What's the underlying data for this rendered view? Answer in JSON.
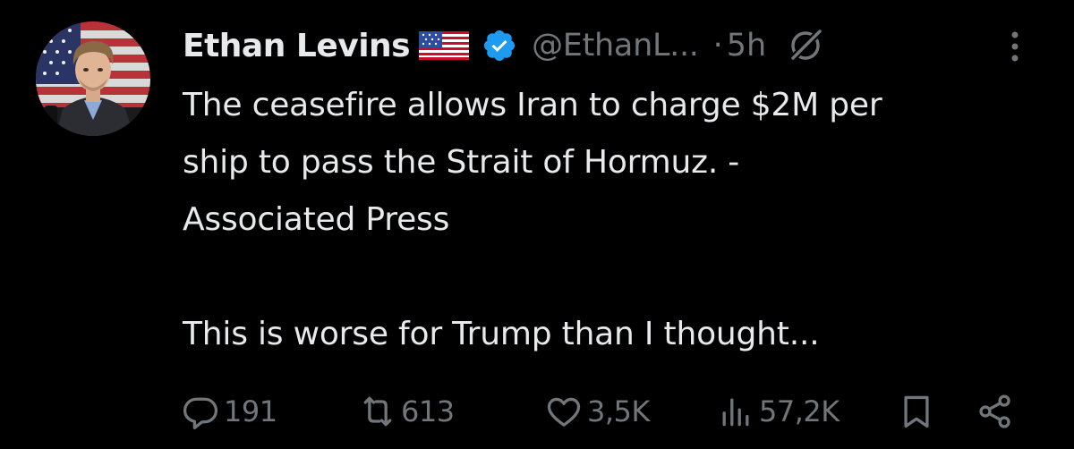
{
  "tweet": {
    "author_name": "Ethan Levins",
    "flag_icon": "us-flag-icon",
    "verified_color": "#1d9bf0",
    "handle": "@EthanL...",
    "separator": "·",
    "time": "5h",
    "text_lines": [
      "The ceasefire allows Iran to charge $2M per\nship to pass the Strait of Hormuz. -\nAssociated Press",
      "This is worse for Trump than I thought..."
    ]
  },
  "actions": {
    "replies": "191",
    "reposts": "613",
    "likes": "3,5K",
    "views": "57,2K"
  },
  "colors": {
    "background": "#000000",
    "text": "#e7e9ea",
    "muted": "#71767b",
    "accent": "#1d9bf0"
  },
  "icons": [
    "avatar",
    "us-flag-icon",
    "verified-badge-icon",
    "grok-icon",
    "more-icon",
    "reply-icon",
    "repost-icon",
    "like-icon",
    "views-icon",
    "bookmark-icon",
    "share-icon"
  ]
}
